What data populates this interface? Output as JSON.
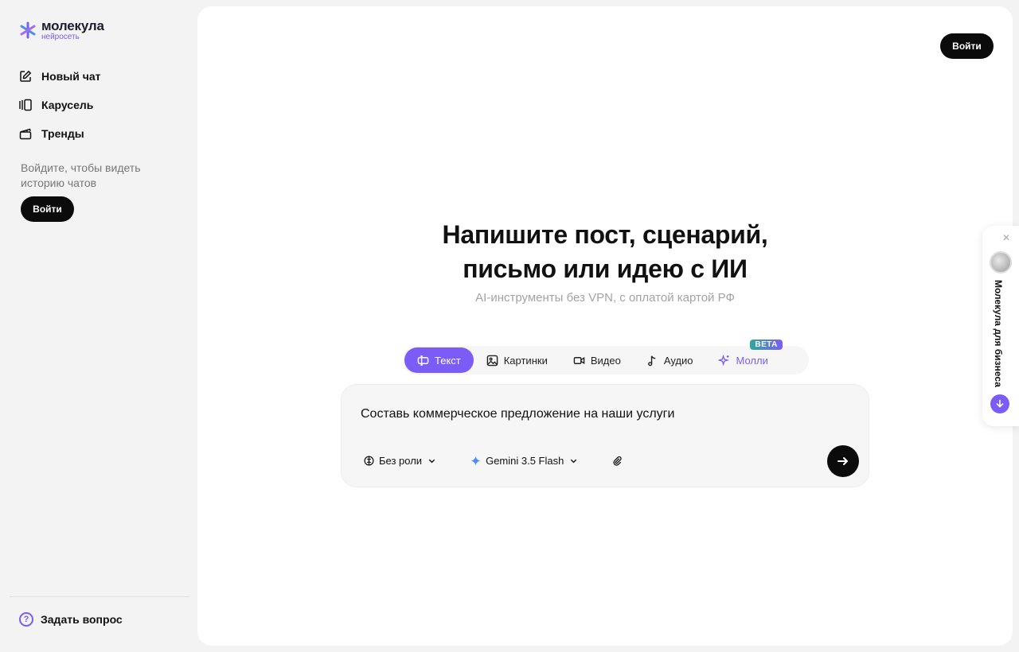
{
  "brand": {
    "name": "молекула",
    "subtitle": "нейросеть",
    "accent": "#7c5cf6"
  },
  "sidebar": {
    "items": [
      {
        "label": "Новый чат",
        "icon": "edit-icon"
      },
      {
        "label": "Карусель",
        "icon": "carousel-icon"
      },
      {
        "label": "Тренды",
        "icon": "clapperboard-icon"
      }
    ],
    "login_hint": "Войдите, чтобы видеть историю чатов",
    "login_label": "Войти",
    "help_label": "Задать вопрос"
  },
  "header": {
    "login_label": "Войти"
  },
  "hero": {
    "title_line1": "Напишите пост, сценарий,",
    "title_line2": "письмо или идею с ИИ",
    "subtitle": "AI-инструменты без VPN, с оплатой картой РФ"
  },
  "tabs": [
    {
      "label": "Текст",
      "icon": "text-icon",
      "active": true
    },
    {
      "label": "Картинки",
      "icon": "image-icon"
    },
    {
      "label": "Видео",
      "icon": "video-icon"
    },
    {
      "label": "Аудио",
      "icon": "music-icon"
    },
    {
      "label": "Молли",
      "icon": "sparkle-icon",
      "badge": "BETA"
    }
  ],
  "composer": {
    "prompt_text": "Составь коммерческое предложение на наши услуги",
    "role_label": "Без роли",
    "model_label": "Gemini 3.5 Flash"
  },
  "business_widget": {
    "label": "Молекула для бизнеса"
  }
}
